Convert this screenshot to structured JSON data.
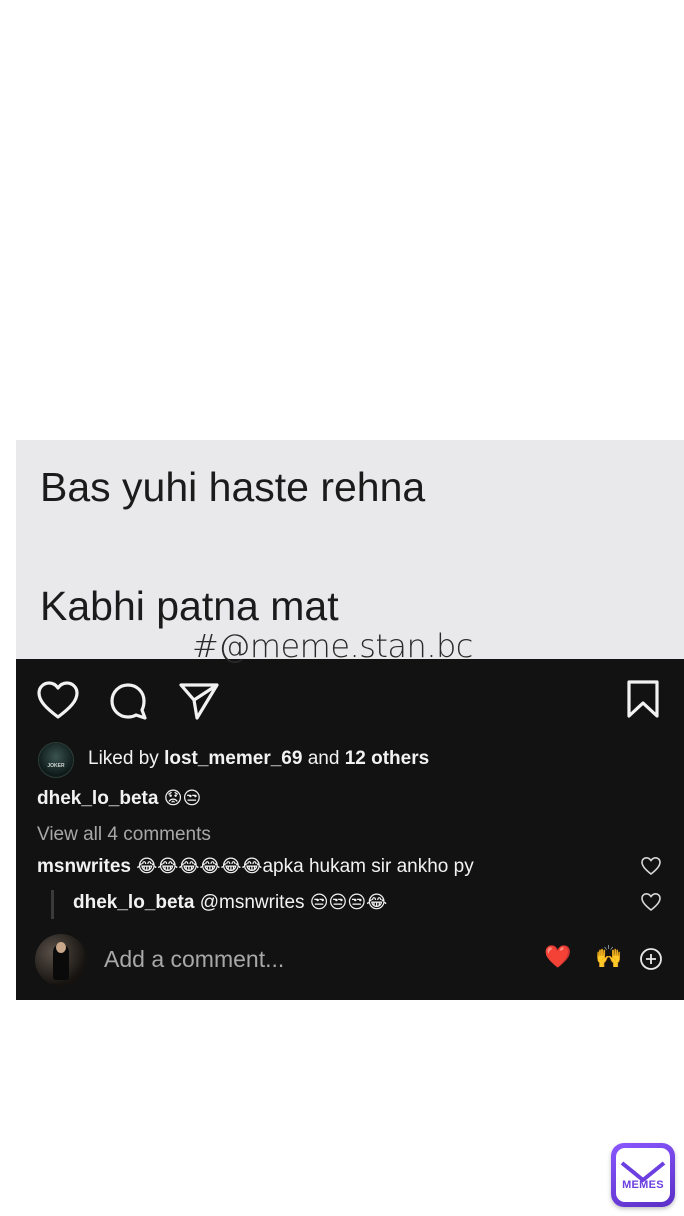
{
  "meme": {
    "line1": "Bas yuhi haste rehna",
    "line2": "Kabhi patna mat",
    "watermark": "#@meme.stan.bc"
  },
  "post": {
    "liked_by_prefix": "Liked by",
    "liked_by_user": "lost_memer_69",
    "liked_by_and": "and",
    "liked_by_others": "12 others",
    "avatar_text": "JOKER",
    "caption_user": "dhek_lo_beta",
    "caption_emojis": "😟😒",
    "view_comments": "View all 4 comments",
    "comments": [
      {
        "user": "msnwrites",
        "emojis": "😂😂😂😂😂😂",
        "text": "apka hukam sir ankho py"
      },
      {
        "user": "dhek_lo_beta",
        "mention": "@msnwrites",
        "emojis": "😒😒😒😂"
      }
    ],
    "add_comment_placeholder": "Add a comment...",
    "quick_reactions": [
      "❤️",
      "🙌"
    ],
    "icons": [
      "heart-icon",
      "comment-icon",
      "share-icon",
      "bookmark-icon",
      "comment-like-icon",
      "add-circle-icon"
    ]
  },
  "brand": {
    "logo_text": "MEMES",
    "accent": "#7a4cf0"
  }
}
